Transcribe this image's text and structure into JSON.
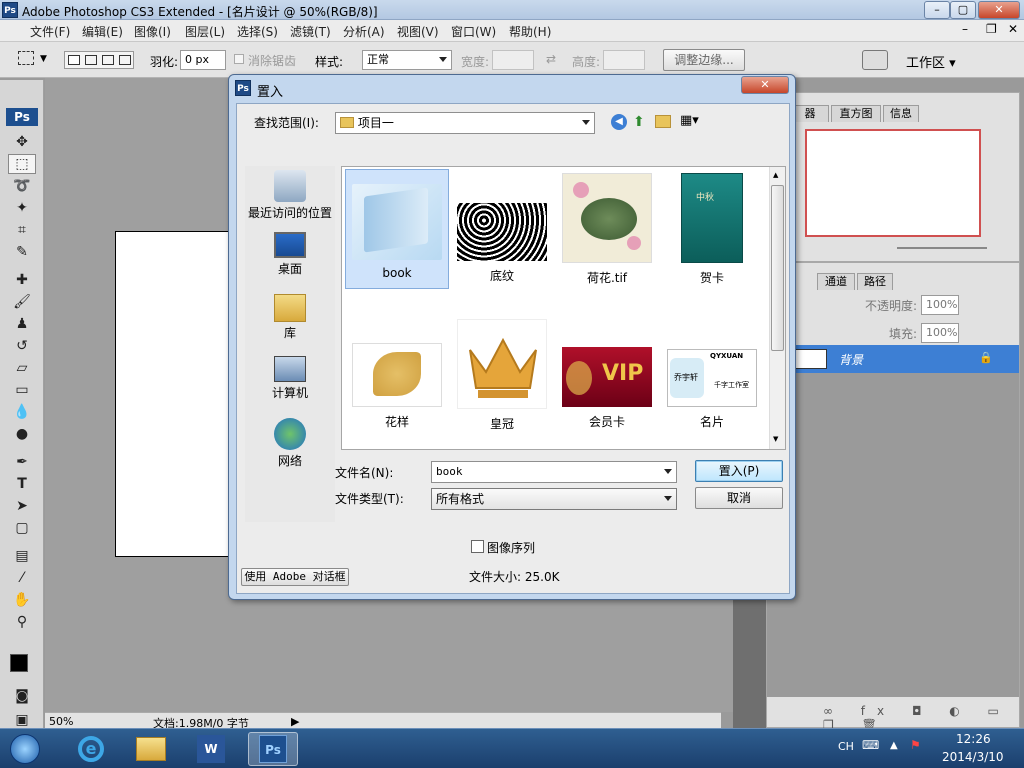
{
  "app": {
    "title": "Adobe Photoshop CS3 Extended - [名片设计 @ 50%(RGB/8)]",
    "logo": "Ps"
  },
  "window_controls": {
    "minimize": "–",
    "maximize": "▢",
    "close": "✕"
  },
  "doc_controls": {
    "minimize": "–",
    "restore": "❐",
    "close": "✕"
  },
  "menu": [
    "文件(F)",
    "编辑(E)",
    "图像(I)",
    "图层(L)",
    "选择(S)",
    "滤镜(T)",
    "分析(A)",
    "视图(V)",
    "窗口(W)",
    "帮助(H)"
  ],
  "options_bar": {
    "feather_label": "羽化:",
    "feather_value": "0 px",
    "antialias_label": "消除锯齿",
    "style_label": "样式:",
    "style_value": "正常",
    "width_label": "宽度:",
    "height_label": "高度:",
    "refine_edge": "调整边缘...",
    "workspace": "工作区 ▾"
  },
  "panels": {
    "navigator_tabs": [
      "器",
      "直方图",
      "信息"
    ],
    "layers_tabs": [
      "通道",
      "路径"
    ],
    "opacity_label": "不透明度:",
    "opacity_value": "100%",
    "fill_label": "填充:",
    "fill_value": "100%",
    "layer_name": "背景"
  },
  "status_bar": {
    "zoom": "50%",
    "doc_info": "文档:1.98M/0 字节"
  },
  "dialog": {
    "title": "置入",
    "look_in_label": "查找范围(I):",
    "look_in_value": "项目一",
    "places": [
      {
        "label": "最近访问的位置",
        "icon": "recent-places-icon"
      },
      {
        "label": "桌面",
        "icon": "desktop-icon"
      },
      {
        "label": "库",
        "icon": "libraries-icon"
      },
      {
        "label": "计算机",
        "icon": "computer-icon"
      },
      {
        "label": "网络",
        "icon": "network-icon"
      }
    ],
    "files": [
      {
        "name": "book",
        "selected": true
      },
      {
        "name": "底纹"
      },
      {
        "name": "荷花.tif"
      },
      {
        "name": "贺卡"
      },
      {
        "name": "花样"
      },
      {
        "name": "皇冠"
      },
      {
        "name": "会员卡"
      },
      {
        "name": "名片"
      }
    ],
    "filename_label": "文件名(N):",
    "filename_value": "book",
    "filetype_label": "文件类型(T):",
    "filetype_value": "所有格式",
    "place_button": "置入(P)",
    "cancel_button": "取消",
    "image_sequence_label": "图像序列",
    "file_size": "文件大小: 25.0K",
    "use_adobe_dialog": "使用 Adobe 对话框",
    "thumb_texts": {
      "vip": "VIP",
      "card_brand": "QYXUAN",
      "card_studio": "千字工作室",
      "card_name": "乔宇轩",
      "greeting": "中秋"
    }
  },
  "taskbar": {
    "lang": "CH",
    "time": "12:26",
    "date": "2014/3/10"
  }
}
